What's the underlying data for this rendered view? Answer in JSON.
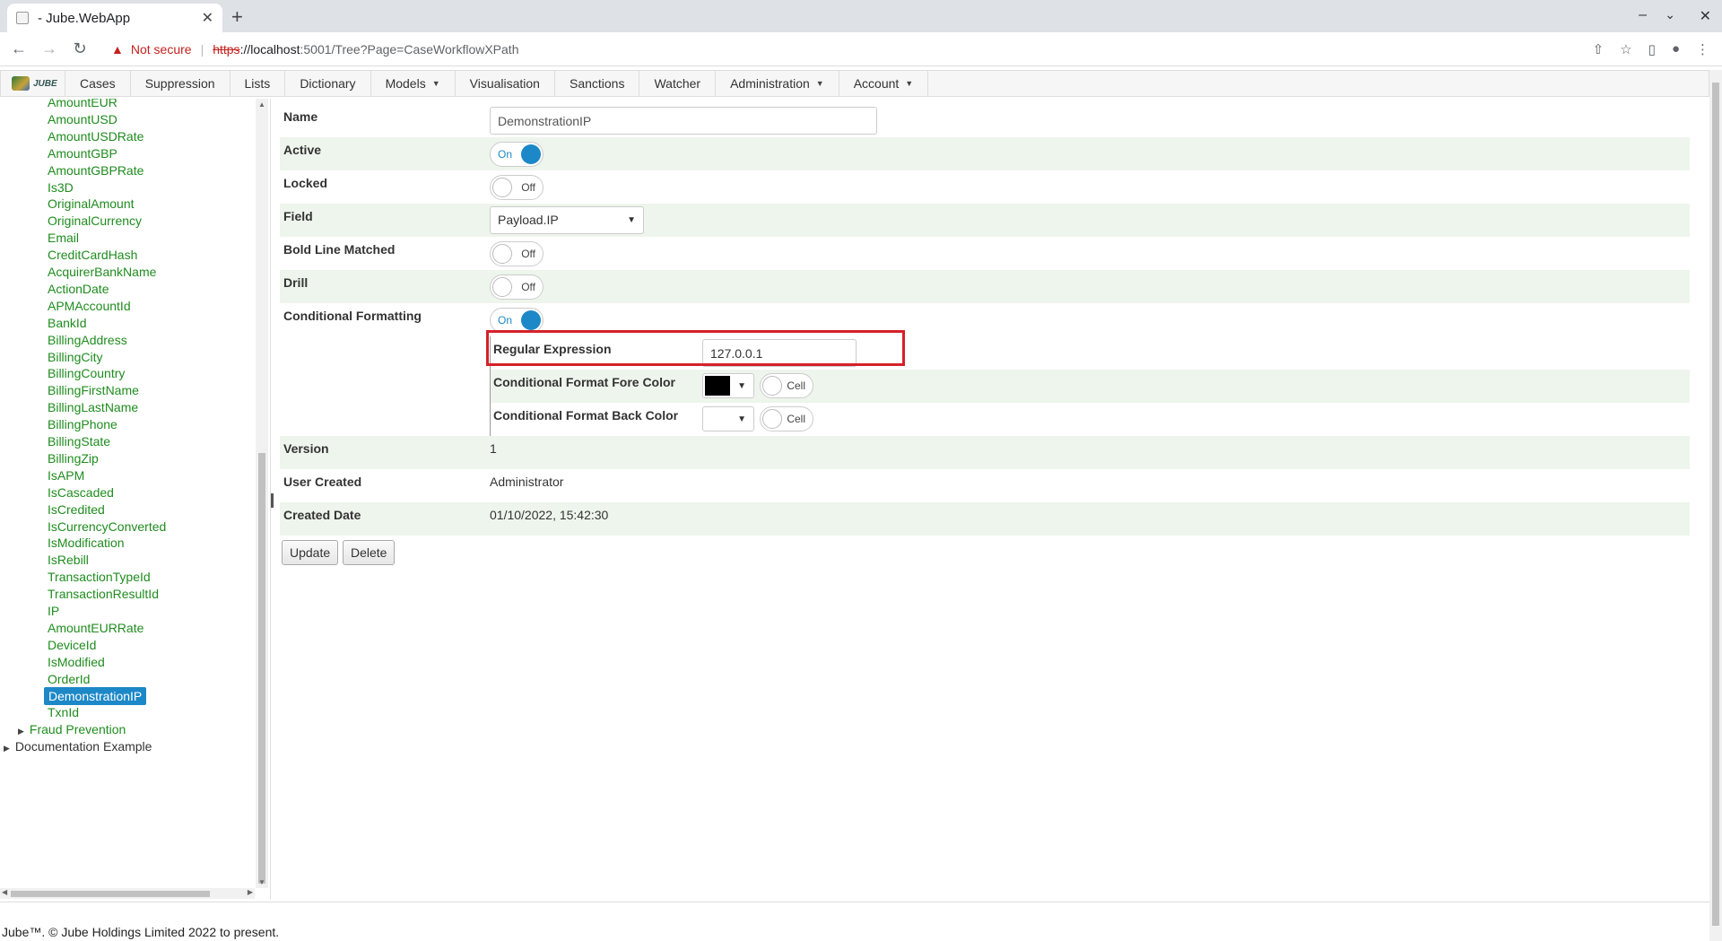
{
  "browser": {
    "tab_title": "- Jube.WebApp",
    "security_label": "Not secure",
    "url_scheme": "https",
    "url_host": "://localhost",
    "url_rest": ":5001/Tree?Page=CaseWorkflowXPath"
  },
  "menu": {
    "logo_text": "JUBE",
    "items": [
      {
        "label": "Cases",
        "dropdown": false
      },
      {
        "label": "Suppression",
        "dropdown": false
      },
      {
        "label": "Lists",
        "dropdown": false
      },
      {
        "label": "Dictionary",
        "dropdown": false
      },
      {
        "label": "Models",
        "dropdown": true
      },
      {
        "label": "Visualisation",
        "dropdown": false
      },
      {
        "label": "Sanctions",
        "dropdown": false
      },
      {
        "label": "Watcher",
        "dropdown": false
      },
      {
        "label": "Administration",
        "dropdown": true
      },
      {
        "label": "Account",
        "dropdown": true
      }
    ]
  },
  "tree": {
    "nodes": [
      "AmountEUR",
      "AmountUSD",
      "AmountUSDRate",
      "AmountGBP",
      "AmountGBPRate",
      "Is3D",
      "OriginalAmount",
      "OriginalCurrency",
      "Email",
      "CreditCardHash",
      "AcquirerBankName",
      "ActionDate",
      "APMAccountId",
      "BankId",
      "BillingAddress",
      "BillingCity",
      "BillingCountry",
      "BillingFirstName",
      "BillingLastName",
      "BillingPhone",
      "BillingState",
      "BillingZip",
      "IsAPM",
      "IsCascaded",
      "IsCredited",
      "IsCurrencyConverted",
      "IsModification",
      "IsRebill",
      "TransactionTypeId",
      "TransactionResultId",
      "IP",
      "AmountEURRate",
      "DeviceId",
      "IsModified",
      "OrderId",
      "DemonstrationIP",
      "TxnId"
    ],
    "selected": "DemonstrationIP",
    "groups": [
      "Fraud Prevention",
      "Documentation Example"
    ]
  },
  "form": {
    "name_label": "Name",
    "name_value": "DemonstrationIP",
    "active_label": "Active",
    "active_state": "On",
    "locked_label": "Locked",
    "locked_state": "Off",
    "field_label": "Field",
    "field_value": "Payload.IP",
    "bold_label": "Bold Line Matched",
    "bold_state": "Off",
    "drill_label": "Drill",
    "drill_state": "Off",
    "cf_label": "Conditional Formatting",
    "cf_state": "On",
    "regex_label": "Regular Expression",
    "regex_value": "127.0.0.1",
    "fore_label": "Conditional Format Fore Color",
    "fore_color": "#000000",
    "fore_cell": "Cell",
    "back_label": "Conditional Format Back Color",
    "back_color": "#ffffff",
    "back_cell": "Cell",
    "version_label": "Version",
    "version_value": "1",
    "user_label": "User Created",
    "user_value": "Administrator",
    "date_label": "Created Date",
    "date_value": "01/10/2022, 15:42:30",
    "update_button": "Update",
    "delete_button": "Delete"
  },
  "footer": "Jube™. © Jube Holdings Limited 2022 to present."
}
